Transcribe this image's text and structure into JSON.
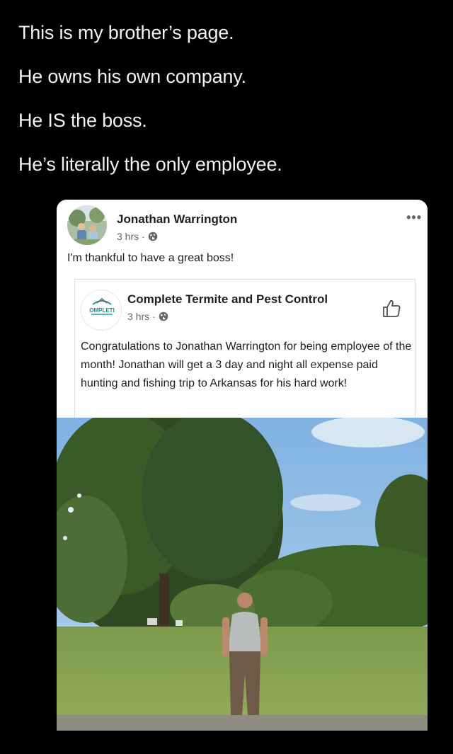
{
  "caption": {
    "lines": [
      "This is my brother’s page.",
      "He owns his own company.",
      "He IS the boss.",
      "He’s literally the only employee."
    ]
  },
  "post": {
    "author": "Jonathan Warrington",
    "time": "3 hrs",
    "separator": "·",
    "privacy_icon": "globe-icon",
    "more_icon": "more-options-icon",
    "more_label": "•••",
    "text": "I'm thankful to have a great boss!",
    "shared": {
      "page_name": "Complete Termite and Pest Control",
      "logo_text": "OMPLETI",
      "time": "3 hrs",
      "separator": "·",
      "privacy_icon": "globe-icon",
      "like_icon": "thumbs-up-icon",
      "text": "Congratulations to Jonathan Warrington for being employee of the month! Jonathan will get a 3 day and night all expense paid hunting and fishing trip to Arkansas for his hard work!"
    }
  },
  "colors": {
    "background": "#000000",
    "card": "#ffffff",
    "text_primary": "#1c1e21",
    "text_secondary": "#65676b",
    "logo_teal": "#1f9a9a"
  }
}
